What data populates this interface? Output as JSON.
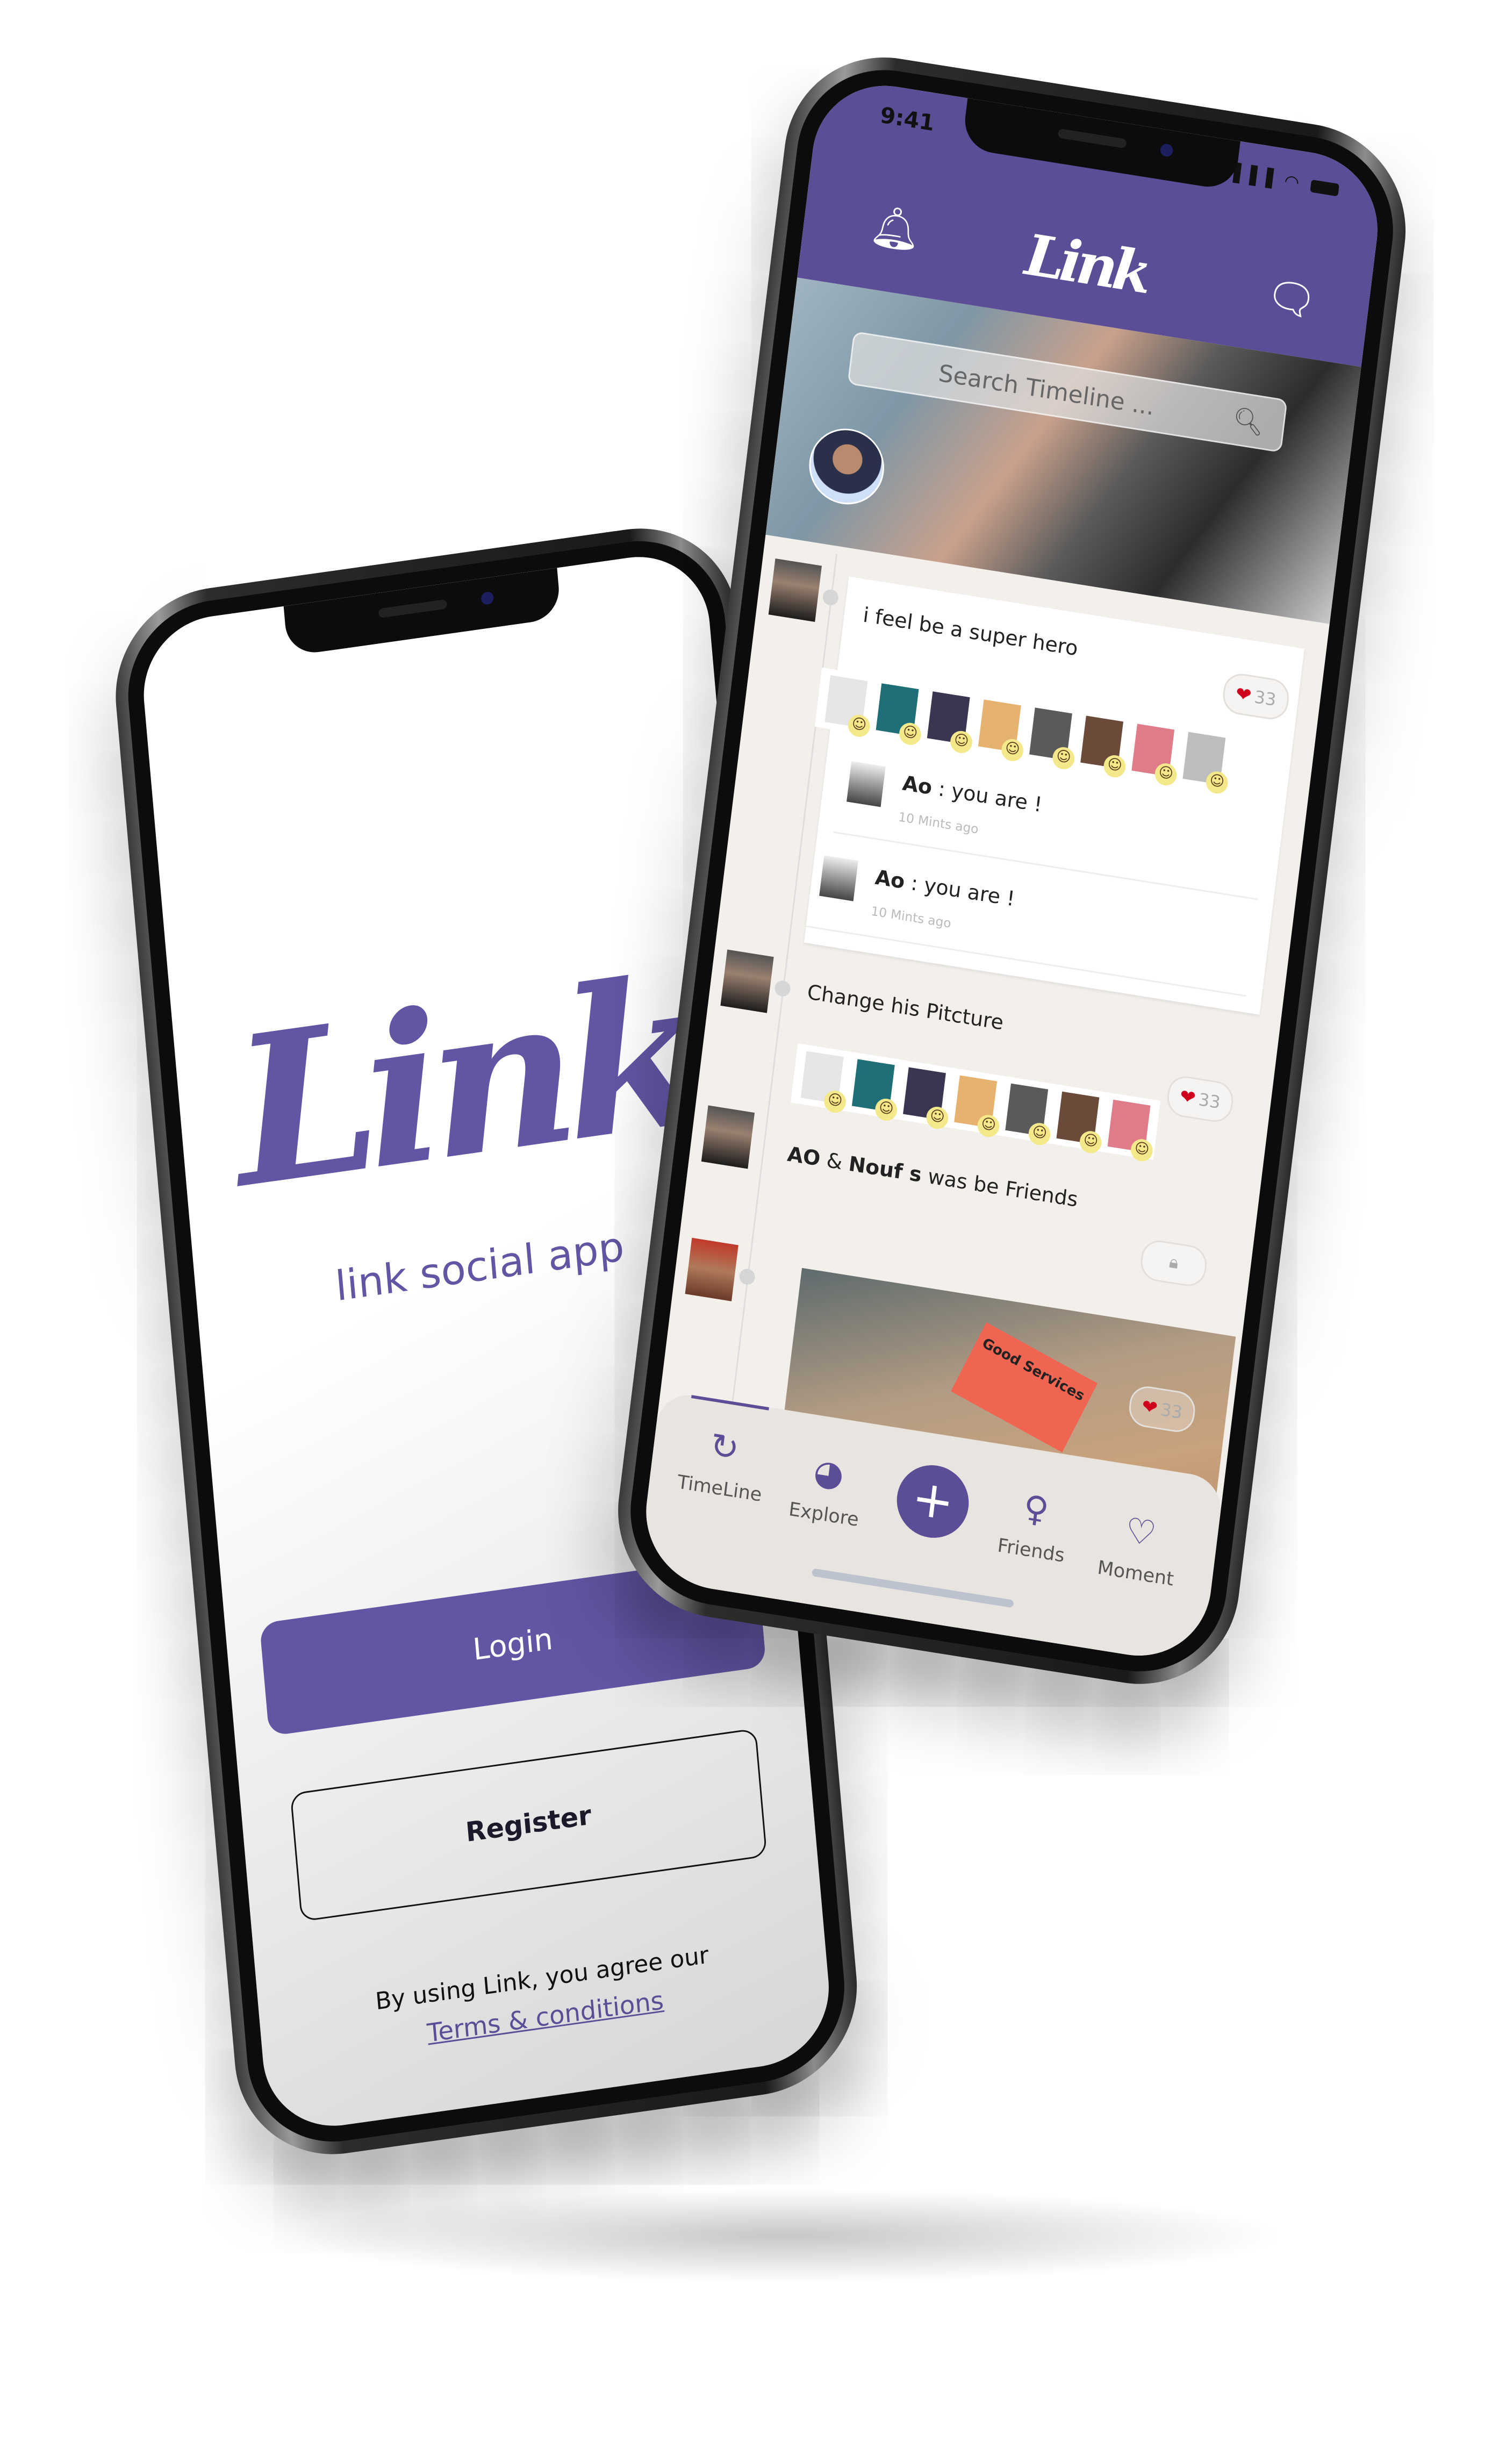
{
  "login_screen": {
    "logo": "Link",
    "tagline": "link social app",
    "login_label": "Login",
    "register_label": "Register",
    "agreement_text": "By using Link, you agree our",
    "terms_link": "Terms & conditions"
  },
  "timeline_screen": {
    "status": {
      "time": "9:41",
      "signal": "▐▐▐",
      "wifi": "◠"
    },
    "header": {
      "logo": "Link",
      "left_icon": "bell-icon",
      "right_icon": "chat-bubbles-icon"
    },
    "search": {
      "placeholder": "Search Timeline ...",
      "icon": "search-icon"
    },
    "posts": [
      {
        "text": "i feel be a super hero",
        "likes": "33",
        "reactions": [
          "#e6e6e6",
          "#1f6f78",
          "#3a3550",
          "#e6b270",
          "#5a5a5a",
          "#6b4a3a",
          "#e07b8a",
          "#bdbdbd"
        ],
        "comments": [
          {
            "author": "Ao",
            "text": " : you are !",
            "time": "10 Mints ago"
          },
          {
            "author": "Ao",
            "text": " : you are !",
            "time": "10 Mints ago"
          }
        ]
      },
      {
        "text": "Change his Pitcture",
        "likes": "33",
        "reactions": [
          "#e6e6e6",
          "#1f6f78",
          "#3a3550",
          "#e6b270",
          "#5a5a5a",
          "#6b4a3a",
          "#e07b8a"
        ]
      },
      {
        "name_a": "AO",
        "joiner": " & ",
        "name_b": "Nouf s",
        "text": " was be Friends",
        "icon": "lock-icon"
      },
      {
        "likes": "33",
        "image_text": "Good Services"
      }
    ],
    "nav": [
      {
        "label": "TimeLine",
        "icon": "↻",
        "active": true
      },
      {
        "label": "Explore",
        "icon": "◕"
      },
      {
        "label": "+",
        "icon": "plus-icon"
      },
      {
        "label": "Friends",
        "icon": "♀"
      },
      {
        "label": "Moment",
        "icon": "♡"
      }
    ]
  },
  "colors": {
    "brand": "#5b4e96",
    "heart": "#d0021b",
    "feed_bg": "#f3f0ec"
  }
}
